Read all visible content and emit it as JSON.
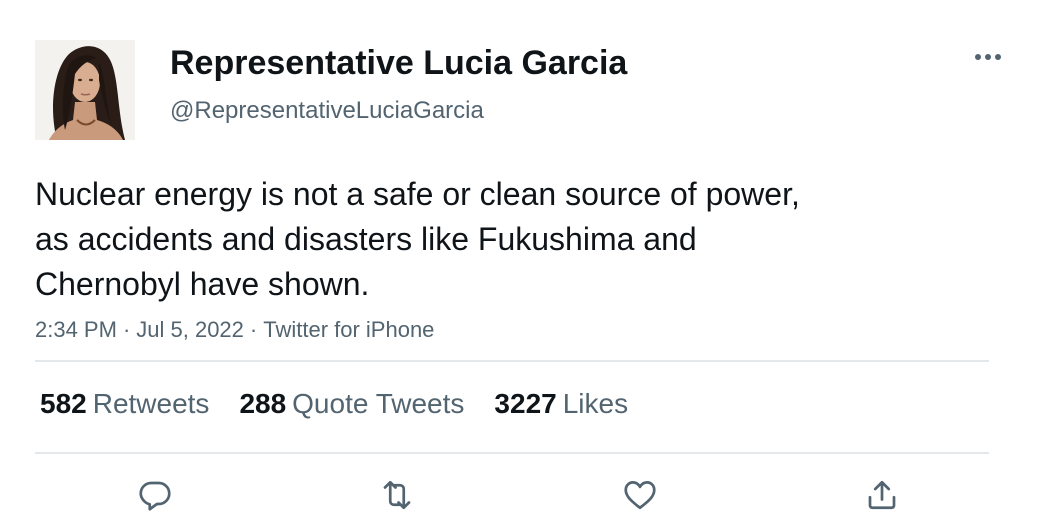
{
  "author": {
    "display_name": "Representative Lucia Garcia",
    "handle": "@RepresentativeLuciaGarcia",
    "avatar_icon": "profile-photo"
  },
  "tweet": {
    "text_lines": [
      "Nuclear energy is not a safe or clean source of power,",
      "as accidents and disasters like Fukushima and",
      "Chernobyl have shown."
    ],
    "time": "2:34 PM",
    "date": "Jul 5, 2022",
    "separator": "·",
    "source": "Twitter for iPhone"
  },
  "stats": {
    "retweets": {
      "count": "582",
      "label": "Retweets"
    },
    "quote_tweets": {
      "count": "288",
      "label": "Quote Tweets"
    },
    "likes": {
      "count": "3227",
      "label": "Likes"
    }
  },
  "actions": {
    "icons": [
      "reply-icon",
      "retweet-icon",
      "like-icon",
      "share-icon"
    ]
  },
  "colors": {
    "text_primary": "#0f1419",
    "text_secondary": "#536471",
    "divider": "#e4e8eb",
    "icon": "#536471"
  }
}
